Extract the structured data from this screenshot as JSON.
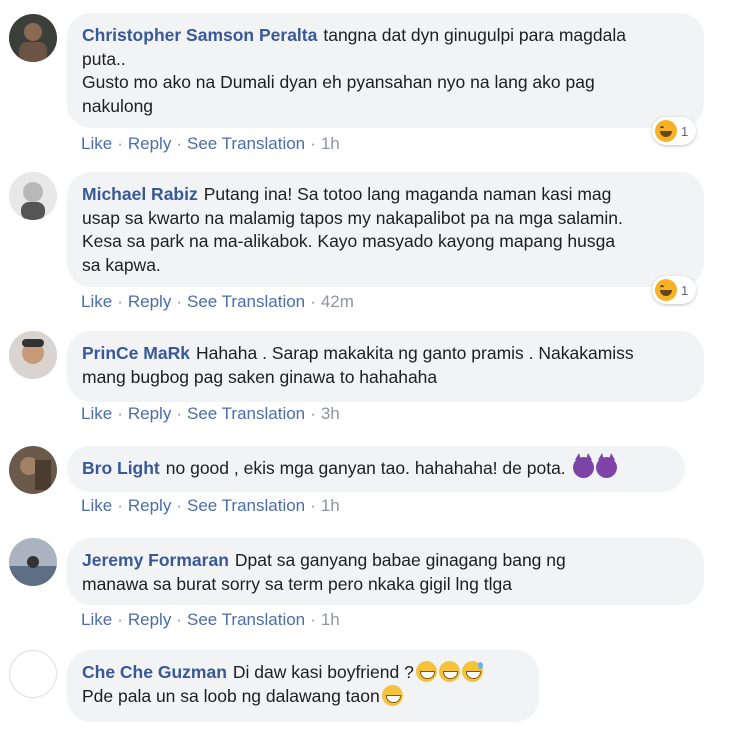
{
  "actions": {
    "like": "Like",
    "reply": "Reply",
    "translate": "See Translation",
    "sep": "·"
  },
  "comments": [
    {
      "name": "Christopher Samson Peralta",
      "lines": [
        "tangna dat dyn ginugulpi para magdala",
        "puta..",
        "Gusto mo ako na Dumali dyan eh pyansahan nyo na lang ako pag",
        "nakulong"
      ],
      "time": "1h",
      "reaction": {
        "icon": "haha-reaction-icon",
        "count": "1"
      }
    },
    {
      "name": "Michael Rabiz",
      "lines": [
        "Putang ina! Sa totoo lang maganda naman kasi mag",
        "usap sa kwarto na malamig tapos my nakapalibot pa na mga salamin.",
        "Kesa sa park na ma-alikabok. Kayo masyado kayong mapang husga",
        "sa kapwa."
      ],
      "time": "42m",
      "reaction": {
        "icon": "haha-reaction-icon",
        "count": "1"
      }
    },
    {
      "name": "PrinCe MaRk",
      "lines": [
        "Hahaha . Sarap makakita ng ganto pramis . Nakakamiss",
        "mang bugbog pag saken ginawa to hahahaha"
      ],
      "time": "3h"
    },
    {
      "name": "Bro Light",
      "lines": [
        "no good , ekis mga ganyan tao. hahahaha! de pota."
      ],
      "emojis": [
        "smiling-imp-icon",
        "smiling-imp-icon"
      ],
      "time": "1h"
    },
    {
      "name": "Jeremy Formaran",
      "lines": [
        "Dpat sa ganyang babae ginagang bang ng",
        "manawa sa burat sorry sa term pero nkaka gigil lng tlga"
      ],
      "time": "1h"
    },
    {
      "name": "Che Che Guzman",
      "lines": [
        "Di daw kasi boyfriend ?",
        "Pde pala un sa loob ng dalawang taon"
      ],
      "emojis_line1": [
        "grinning-face-icon",
        "grinning-face-icon",
        "grinning-sweat-icon"
      ],
      "emojis_line2": [
        "smiling-face-icon"
      ]
    }
  ]
}
